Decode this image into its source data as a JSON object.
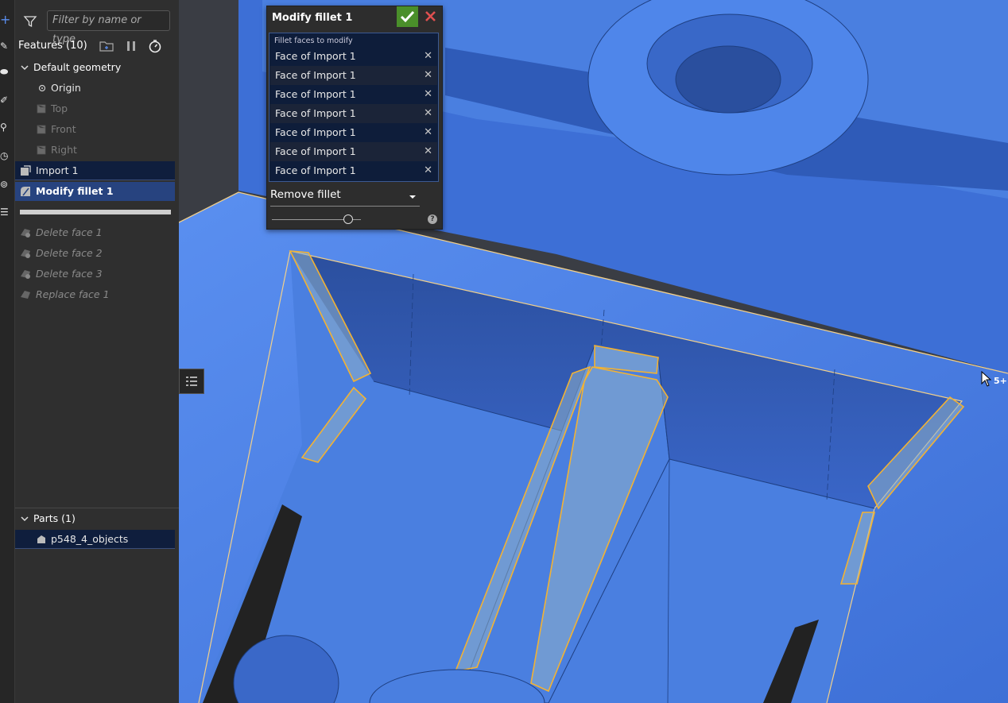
{
  "feature_panel": {
    "filter_placeholder": "Filter by name or type",
    "features_header": "Features (10)",
    "default_geometry_label": "Default geometry",
    "items": [
      {
        "label": "Origin"
      },
      {
        "label": "Top"
      },
      {
        "label": "Front"
      },
      {
        "label": "Right"
      },
      {
        "label": "Import 1"
      },
      {
        "label": "Modify fillet 1"
      },
      {
        "label": "Delete face 1"
      },
      {
        "label": "Delete face 2"
      },
      {
        "label": "Delete face 3"
      },
      {
        "label": "Replace face 1"
      }
    ],
    "parts_header": "Parts (1)",
    "parts": [
      {
        "label": "p548_4_objects"
      }
    ]
  },
  "dialog": {
    "title": "Modify fillet 1",
    "faces_caption": "Fillet faces to modify",
    "faces": [
      "Face of Import 1",
      "Face of Import 1",
      "Face of Import 1",
      "Face of Import 1",
      "Face of Import 1",
      "Face of Import 1",
      "Face of Import 1"
    ],
    "mode_value": "Remove fillet"
  },
  "viewport": {
    "cursor_badge": "5+"
  },
  "colors": {
    "accent": "#27437f",
    "model_blue": "#4a7fe0",
    "highlight_orange": "#f2b233",
    "ok_green": "#4a8f2a",
    "cancel_red": "#e05050"
  },
  "icons": [
    "filter-icon",
    "add-folder-icon",
    "pause-icon",
    "timer-icon",
    "chevron-down-icon",
    "origin-icon",
    "plane-icon",
    "import-icon",
    "fillet-icon",
    "delete-face-icon",
    "replace-face-icon",
    "part-icon",
    "check-icon",
    "close-icon",
    "help-icon",
    "list-icon",
    "cursor-icon"
  ]
}
